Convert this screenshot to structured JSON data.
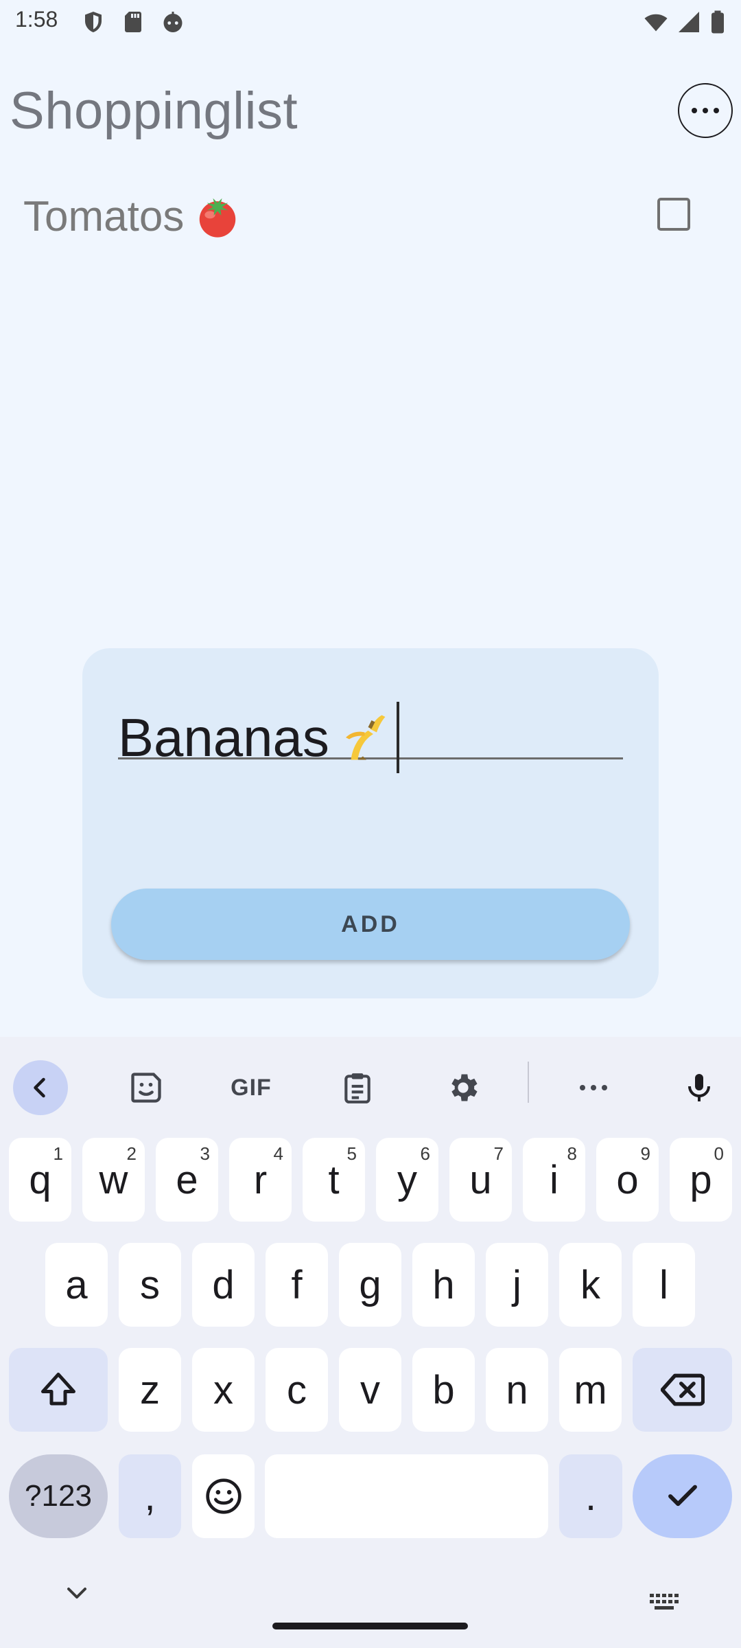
{
  "status_bar": {
    "time": "1:58",
    "left_icons": [
      "shield-icon",
      "sd-card-icon",
      "robot-face-icon"
    ],
    "right_icons": [
      "wifi-icon",
      "cell-signal-icon",
      "battery-icon"
    ]
  },
  "app_bar": {
    "title": "Shoppinglist",
    "menu_icon": "more-horizontal-icon"
  },
  "list": {
    "items": [
      {
        "label": "Tomatos",
        "emoji": "tomato-emoji",
        "checked": false
      }
    ]
  },
  "add_dialog": {
    "input_value": "Bananas",
    "input_emoji": "banana-emoji",
    "button_label": "ADD"
  },
  "keyboard": {
    "toolbar": {
      "gif_label": "GIF",
      "icons": [
        "back-chevron-icon",
        "sticker-icon",
        "clipboard-icon",
        "settings-icon",
        "more-icon",
        "microphone-icon"
      ]
    },
    "row1": [
      {
        "k": "q",
        "h": "1"
      },
      {
        "k": "w",
        "h": "2"
      },
      {
        "k": "e",
        "h": "3"
      },
      {
        "k": "r",
        "h": "4"
      },
      {
        "k": "t",
        "h": "5"
      },
      {
        "k": "y",
        "h": "6"
      },
      {
        "k": "u",
        "h": "7"
      },
      {
        "k": "i",
        "h": "8"
      },
      {
        "k": "o",
        "h": "9"
      },
      {
        "k": "p",
        "h": "0"
      }
    ],
    "row2": [
      "a",
      "s",
      "d",
      "f",
      "g",
      "h",
      "j",
      "k",
      "l"
    ],
    "row3": [
      "z",
      "x",
      "c",
      "v",
      "b",
      "n",
      "m"
    ],
    "num_label": "?123",
    "comma_label": ",",
    "period_label": "."
  },
  "colors": {
    "background": "#f0f6fe",
    "card": "#deebf9",
    "add_button": "#a6d0f2",
    "keyboard_bg": "#eef0f8",
    "enter_key": "#b7cafa"
  }
}
